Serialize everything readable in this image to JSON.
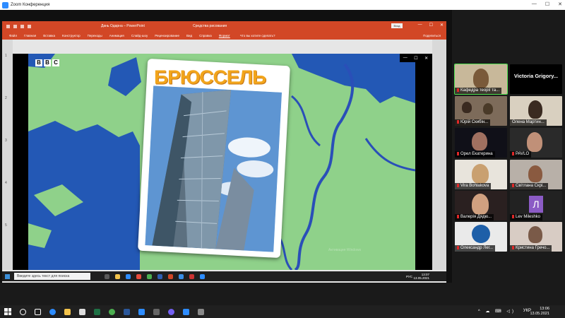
{
  "zoom": {
    "title": "Zoom Конференция",
    "controls": [
      "—",
      "☐",
      "✕"
    ]
  },
  "powerpoint": {
    "doc_title": "Дань Одарна  –  PowerPoint",
    "tools_label": "Средства рисования",
    "login_label": "Вход",
    "window_controls": [
      "—",
      "☐",
      "✕"
    ],
    "menu": [
      "Файл",
      "Главная",
      "Вставка",
      "Конструктор",
      "Переходы",
      "Анимация",
      "Слайд-шоу",
      "Рецензирование",
      "Вид",
      "Справка",
      "Формат"
    ],
    "active_menu_index": 10,
    "tell_me": "Что вы хотите сделать?",
    "share": "Поделиться",
    "ruler_numbers": [
      "1",
      "2",
      "3",
      "4",
      "5"
    ],
    "slideshow_controls": [
      "—",
      "☐",
      "✕"
    ]
  },
  "slide": {
    "logo_letters": [
      "B",
      "B",
      "C"
    ],
    "card_title": "БРЮССЕЛЬ",
    "watermark": "Активация Windows",
    "colors": {
      "map_land": "#8fd18a",
      "map_sea": "#2358b5",
      "river": "#2a4fb8",
      "title": "#f2a51b"
    }
  },
  "inner_taskbar": {
    "search_placeholder": "Введите здесь текст для поиска",
    "lang": "РУС",
    "time": "13:07",
    "date": "13.05.2021"
  },
  "participants": [
    {
      "name": "Кафедра теорії та...",
      "speaking": true,
      "muted": true
    },
    {
      "name": "Victoria_Grigory...",
      "big_name": "Victoria Grigory...",
      "muted": false
    },
    {
      "name": "Юрій Скибін...",
      "muted": true
    },
    {
      "name": "Олена Мартин...",
      "muted": false
    },
    {
      "name": "Орел Екатерина",
      "muted": true
    },
    {
      "name": "PAVLO",
      "muted": true
    },
    {
      "name": "Vira Bohlakova",
      "muted": true
    },
    {
      "name": "Світлана Скрі...",
      "muted": true
    },
    {
      "name": "Валерія Дядю...",
      "muted": true
    },
    {
      "name": "Lev Mileshko",
      "avatar_letter": "Л",
      "muted": true
    },
    {
      "name": "Олександр Лег...",
      "muted": true
    },
    {
      "name": "Кристина Гречо...",
      "muted": true
    }
  ],
  "taskbar": {
    "lang": "УКР",
    "time": "13:06",
    "date": "13.05.2021",
    "tray": "^ ☁ ⌨ ◁)"
  }
}
